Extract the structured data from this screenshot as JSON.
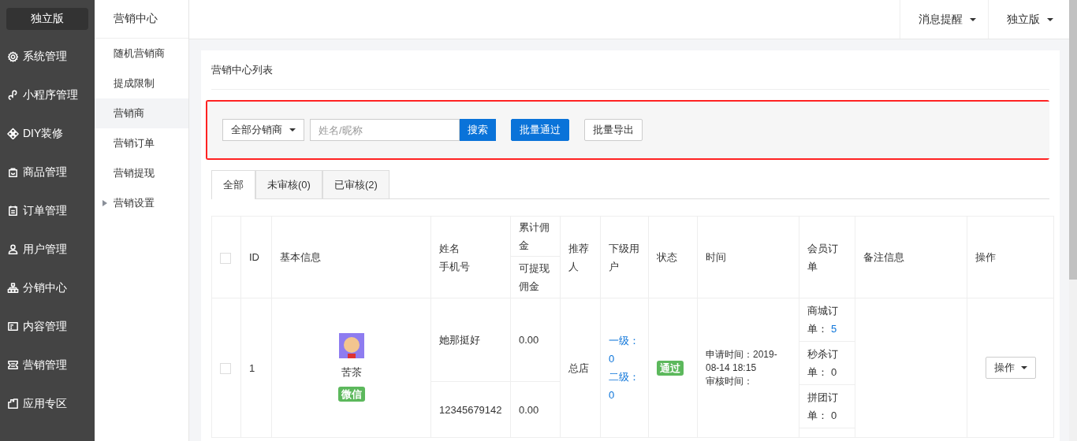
{
  "sidebar": {
    "brand": "独立版",
    "items": [
      {
        "label": "系统管理"
      },
      {
        "label": "小程序管理"
      },
      {
        "label": "DIY装修"
      },
      {
        "label": "商品管理"
      },
      {
        "label": "订单管理"
      },
      {
        "label": "用户管理"
      },
      {
        "label": "分销中心"
      },
      {
        "label": "内容管理"
      },
      {
        "label": "营销管理"
      },
      {
        "label": "应用专区"
      }
    ]
  },
  "submenu": {
    "title": "营销中心",
    "items": [
      {
        "label": "随机营销商",
        "kind": "item",
        "selected": false
      },
      {
        "label": "提成限制",
        "kind": "item",
        "selected": false
      },
      {
        "label": "营销商",
        "kind": "item",
        "selected": true
      },
      {
        "label": "营销订单",
        "kind": "item",
        "selected": false
      },
      {
        "label": "营销提现",
        "kind": "item",
        "selected": false
      },
      {
        "label": "营销设置",
        "kind": "folder",
        "selected": false,
        "expanded": false
      }
    ]
  },
  "topbar": {
    "menus": [
      {
        "label": "消息提醒"
      },
      {
        "label": "独立版"
      }
    ]
  },
  "card": {
    "title": "营销中心列表"
  },
  "toolbar": {
    "filter": {
      "value": "全部分销商"
    },
    "search": {
      "placeholder": "姓名/昵称",
      "button": "搜索"
    },
    "buttons": [
      {
        "label": "批量通过",
        "kind": "primary"
      },
      {
        "label": "批量导出",
        "kind": "default"
      }
    ]
  },
  "tabs": [
    {
      "label": "全部",
      "selected": true
    },
    {
      "label": "未审核(0)",
      "selected": false
    },
    {
      "label": "已审核(2)",
      "selected": false
    }
  ],
  "table": {
    "columns": {
      "select_all_checked": false,
      "id": "ID",
      "basic_info": "基本信息",
      "name": "姓名",
      "phone": "手机号",
      "total_commission": "累计佣金",
      "withdrawable": "可提现佣金",
      "referrer": "推荐人",
      "subordinates": "下级用户",
      "status": "状态",
      "time": "时间",
      "member_orders": "会员订单",
      "remark": "备注信息",
      "action": "操作"
    },
    "rows": [
      {
        "checked": false,
        "id": "1",
        "nickname": "苦茶",
        "source": "微信",
        "name": "她那挺好",
        "phone": "12345679142",
        "total_commission": "0.00",
        "withdrawable": "0.00",
        "referrer": "总店",
        "subordinates": [
          "一级：0",
          "二级：0"
        ],
        "status": {
          "label": "通过",
          "color": "#5cb85c"
        },
        "apply_time": "申请时间：2019-08-14 18:15",
        "audit_time": "审核时间：",
        "member_orders": [
          {
            "label": "商城订单：",
            "count": "5",
            "link": true
          },
          {
            "label": "秒杀订单：",
            "count": "0",
            "link": false
          },
          {
            "label": "拼团订单：",
            "count": "0",
            "link": false
          }
        ],
        "action": "操作"
      }
    ]
  }
}
